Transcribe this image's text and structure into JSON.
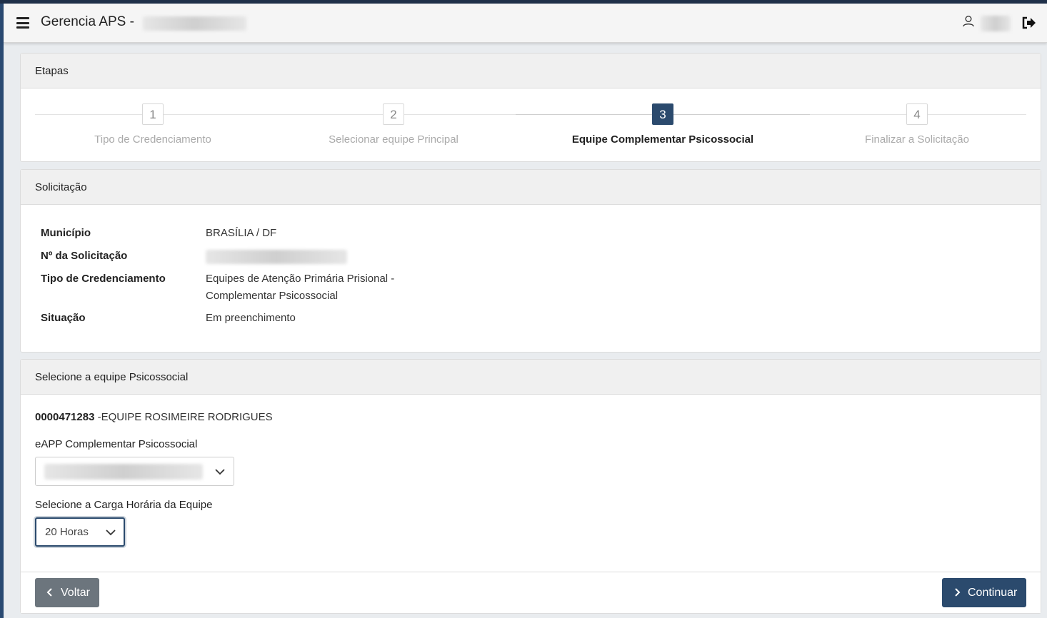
{
  "header": {
    "app_title": "Gerencia APS -",
    "menu_icon": "hamburger-menu-icon",
    "user_icon": "user-icon",
    "logout_icon": "logout-icon"
  },
  "etapas": {
    "title": "Etapas",
    "steps": [
      {
        "number": "1",
        "label": "Tipo de Credenciamento",
        "active": false
      },
      {
        "number": "2",
        "label": "Selecionar equipe Principal",
        "active": false
      },
      {
        "number": "3",
        "label": "Equipe Complementar Psicossocial",
        "active": true
      },
      {
        "number": "4",
        "label": "Finalizar a Solicitação",
        "active": false
      }
    ]
  },
  "solicitacao": {
    "title": "Solicitação",
    "municipio_label": "Município",
    "municipio_value": "BRASÍLIA / DF",
    "numero_label": "Nº da Solicitação",
    "tipo_label": "Tipo de Credenciamento",
    "tipo_value": "Equipes de Atenção Primária Prisional - Complementar Psicossocial",
    "situacao_label": "Situação",
    "situacao_value": "Em preenchimento"
  },
  "equipe": {
    "title": "Selecione a equipe Psicossocial",
    "team_code": "0000471283",
    "team_name": " -EQUIPE ROSIMEIRE RODRIGUES",
    "eapp_label": "eAPP Complementar Psicossocial",
    "carga_label": "Selecione a Carga Horária da Equipe",
    "carga_value": "20 Horas"
  },
  "footer": {
    "voltar_label": "Voltar",
    "continuar_label": "Continuar"
  },
  "colors": {
    "primary": "#2b4a6d",
    "secondary": "#6c757d",
    "top_bar": "#1f3049"
  }
}
